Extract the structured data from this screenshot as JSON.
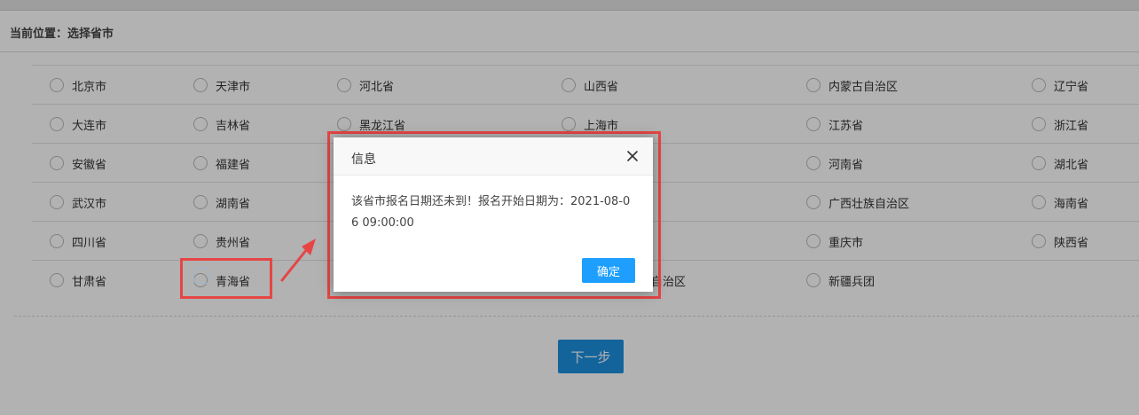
{
  "breadcrumb": "当前位置：选择省市",
  "rows": [
    [
      "北京市",
      "天津市",
      "河北省",
      "山西省",
      "内蒙古自治区",
      "辽宁省"
    ],
    [
      "大连市",
      "吉林省",
      "黑龙江省",
      "上海市",
      "江苏省",
      "浙江省"
    ],
    [
      "安徽省",
      "福建省",
      "",
      "",
      "河南省",
      "湖北省"
    ],
    [
      "武汉市",
      "湖南省",
      "",
      "",
      "广西壮族自治区",
      "海南省"
    ],
    [
      "四川省",
      "贵州省",
      "",
      "",
      "重庆市",
      "陕西省"
    ],
    [
      "甘肃省",
      "青海省",
      "",
      "自治区",
      "新疆兵团",
      ""
    ]
  ],
  "next_button": "下一步",
  "dialog": {
    "title": "信息",
    "message": "该省市报名日期还未到！报名开始日期为：2021-08-06 09:00:00",
    "ok_button": "确定"
  },
  "colors": {
    "accent": "#1e9fff",
    "annotation": "#e64545"
  },
  "icons": {
    "close": "close-icon",
    "radio": "radio-icon",
    "arrow": "arrow-icon"
  }
}
